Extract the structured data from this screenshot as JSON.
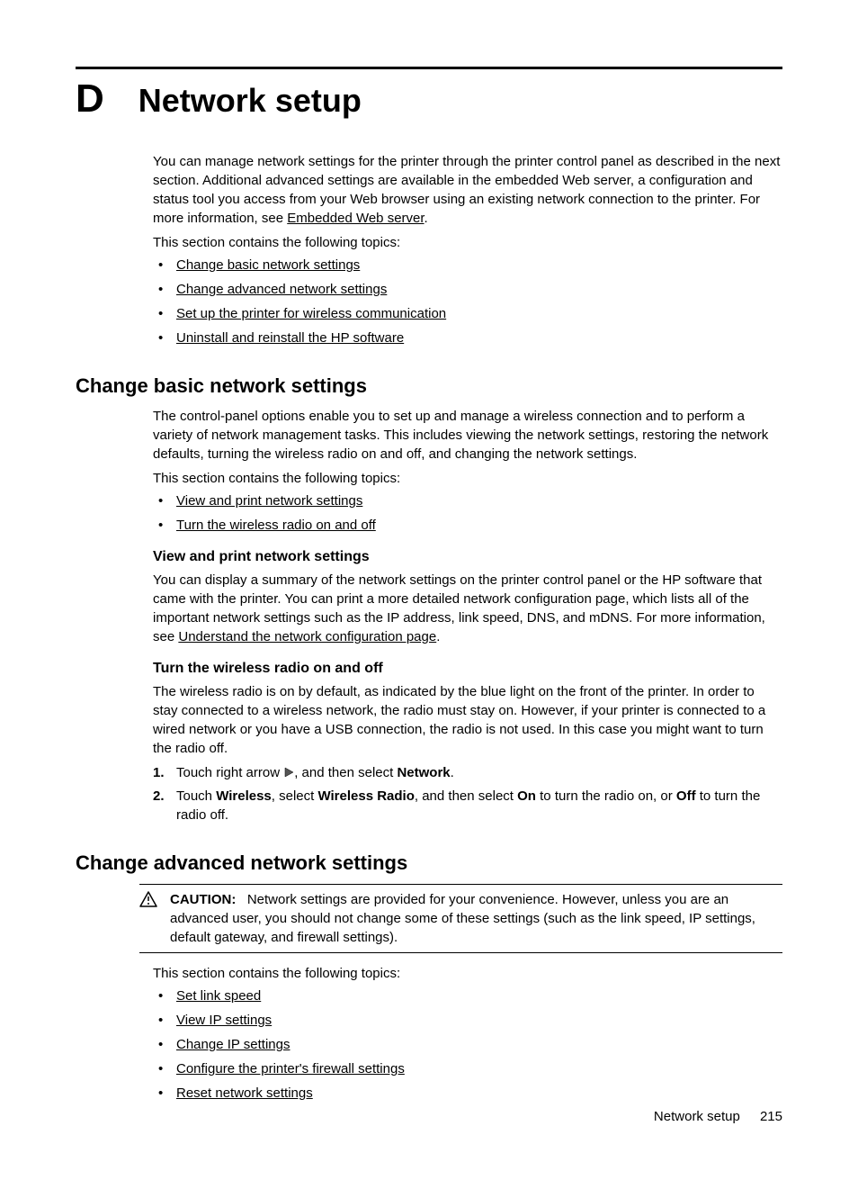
{
  "appendix": {
    "letter": "D",
    "title": "Network setup"
  },
  "intro": {
    "para1a": "You can manage network settings for the printer through the printer control panel as described in the next section. Additional advanced settings are available in the embedded Web server, a configuration and status tool you access from your Web browser using an existing network connection to the printer. For more information, see ",
    "para1_link": "Embedded Web server",
    "para1b": ".",
    "lead": "This section contains the following topics:",
    "topics": [
      "Change basic network settings",
      "Change advanced network settings",
      "Set up the printer for wireless communication",
      "Uninstall and reinstall the HP software"
    ]
  },
  "basic": {
    "heading": "Change basic network settings",
    "para": "The control-panel options enable you to set up and manage a wireless connection and to perform a variety of network management tasks. This includes viewing the network settings, restoring the network defaults, turning the wireless radio on and off, and changing the network settings.",
    "lead": "This section contains the following topics:",
    "topics": [
      "View and print network settings",
      "Turn the wireless radio on and off"
    ]
  },
  "view_print": {
    "heading": "View and print network settings",
    "para_a": "You can display a summary of the network settings on the printer control panel or the HP software that came with the printer. You can print a more detailed network configuration page, which lists all of the important network settings such as the IP address, link speed, DNS, and mDNS. For more information, see ",
    "para_link": "Understand the network configuration page",
    "para_b": "."
  },
  "radio": {
    "heading": "Turn the wireless radio on and off",
    "para": "The wireless radio is on by default, as indicated by the blue light on the front of the printer. In order to stay connected to a wireless network, the radio must stay on. However, if your printer is connected to a wired network or you have a USB connection, the radio is not used. In this case you might want to turn the radio off.",
    "step1_a": "Touch right arrow ",
    "step1_b": ", and then select ",
    "step1_bold": "Network",
    "step1_c": ".",
    "step2_a": "Touch ",
    "step2_b1": "Wireless",
    "step2_c": ", select ",
    "step2_b2": "Wireless Radio",
    "step2_d": ", and then select ",
    "step2_b3": "On",
    "step2_e": " to turn the radio on, or ",
    "step2_b4": "Off",
    "step2_f": " to turn the radio off."
  },
  "advanced": {
    "heading": "Change advanced network settings",
    "caution_label": "CAUTION:",
    "caution_text": "Network settings are provided for your convenience. However, unless you are an advanced user, you should not change some of these settings (such as the link speed, IP settings, default gateway, and firewall settings).",
    "lead": "This section contains the following topics:",
    "topics": [
      "Set link speed",
      "View IP settings",
      "Change IP settings",
      "Configure the printer's firewall settings",
      "Reset network settings"
    ]
  },
  "footer": {
    "label": "Network setup",
    "page": "215"
  }
}
